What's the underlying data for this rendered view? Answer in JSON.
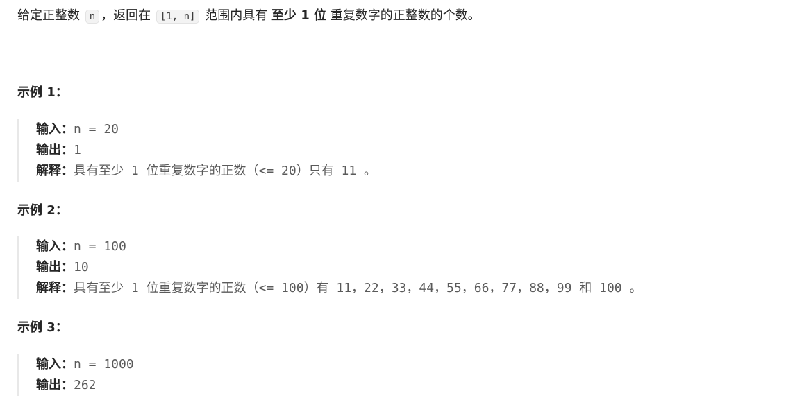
{
  "intro": {
    "part1": "给定正整数 ",
    "code_n": "n",
    "part2": "，返回在 ",
    "code_range": "[1, n]",
    "part3": " 范围内具有 ",
    "bold": "至少 1 位",
    "part4": " 重复数字的正整数的个数。"
  },
  "examples": [
    {
      "title": "示例 1：",
      "input_label": "输入：",
      "input_value": "n = 20",
      "output_label": "输出：",
      "output_value": "1",
      "explain_label": "解释：",
      "explain_value": "具有至少 1 位重复数字的正数（<= 20）只有 11 。"
    },
    {
      "title": "示例 2：",
      "input_label": "输入：",
      "input_value": "n = 100",
      "output_label": "输出：",
      "output_value": "10",
      "explain_label": "解释：",
      "explain_value": "具有至少 1 位重复数字的正数（<= 100）有 11，22，33，44，55，66，77，88，99 和 100 。"
    },
    {
      "title": "示例 3：",
      "input_label": "输入：",
      "input_value": "n = 1000",
      "output_label": "输出：",
      "output_value": "262"
    }
  ]
}
